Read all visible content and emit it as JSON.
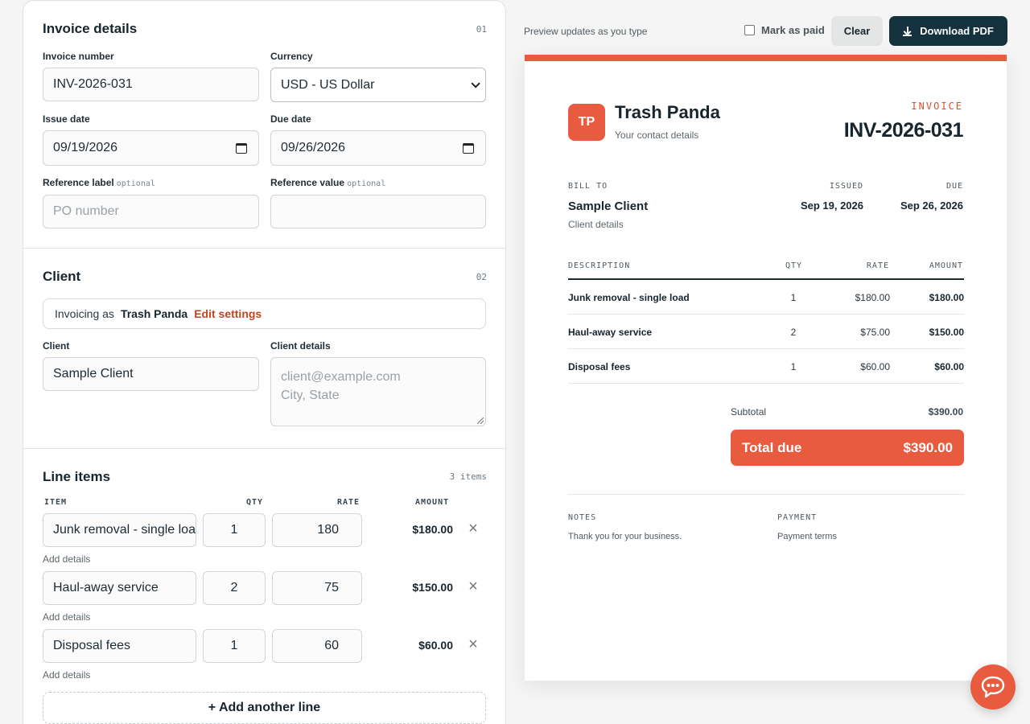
{
  "invoice_details": {
    "title": "Invoice details",
    "num": "01",
    "invoice_number_label": "Invoice number",
    "invoice_number": "INV-2026-031",
    "currency_label": "Currency",
    "currency": "USD - US Dollar",
    "issue_date_label": "Issue date",
    "issue_date": "09/19/2026",
    "due_date_label": "Due date",
    "due_date": "09/26/2026",
    "reference_label_label": "Reference label",
    "reference_value_label": "Reference value",
    "optional": "optional",
    "reference_label_placeholder": "PO number",
    "reference_value": ""
  },
  "client": {
    "title": "Client",
    "num": "02",
    "invoicing_as": "Invoicing as",
    "business_name": "Trash Panda",
    "edit_settings": "Edit settings",
    "client_label": "Client",
    "client_value": "Sample Client",
    "details_label": "Client details",
    "details_placeholder_1": "client@example.com",
    "details_placeholder_2": "City, State"
  },
  "line_items": {
    "title": "Line items",
    "count": "3 items",
    "headers": {
      "item": "ITEM",
      "qty": "QTY",
      "rate": "RATE",
      "amount": "AMOUNT"
    },
    "add_details": "Add details",
    "add_line": "+ Add another line",
    "rows": [
      {
        "item": "Junk removal - single load",
        "qty": "1",
        "rate": "180",
        "amount": "$180.00"
      },
      {
        "item": "Haul-away service",
        "qty": "2",
        "rate": "75",
        "amount": "$150.00"
      },
      {
        "item": "Disposal fees",
        "qty": "1",
        "rate": "60",
        "amount": "$60.00"
      }
    ]
  },
  "toolbar": {
    "hint": "Preview updates as you type",
    "mark_paid": "Mark as paid",
    "clear": "Clear",
    "download": "Download PDF"
  },
  "preview": {
    "logo_initials": "TP",
    "business_name": "Trash Panda",
    "contact": "Your contact details",
    "invoice_word": "INVOICE",
    "invoice_number": "INV-2026-031",
    "bill_to_label": "BILL TO",
    "client_name": "Sample Client",
    "client_details": "Client details",
    "issued_label": "ISSUED",
    "issued": "Sep 19, 2026",
    "due_label": "DUE",
    "due": "Sep 26, 2026",
    "headers": {
      "description": "DESCRIPTION",
      "qty": "QTY",
      "rate": "RATE",
      "amount": "AMOUNT"
    },
    "rows": [
      {
        "description": "Junk removal - single load",
        "qty": "1",
        "rate": "$180.00",
        "amount": "$180.00"
      },
      {
        "description": "Haul-away service",
        "qty": "2",
        "rate": "$75.00",
        "amount": "$150.00"
      },
      {
        "description": "Disposal fees",
        "qty": "1",
        "rate": "$60.00",
        "amount": "$60.00"
      }
    ],
    "subtotal_label": "Subtotal",
    "subtotal": "$390.00",
    "total_label": "Total due",
    "total": "$390.00",
    "notes_label": "NOTES",
    "notes": "Thank you for your business.",
    "payment_label": "PAYMENT",
    "payment": "Payment terms"
  },
  "colors": {
    "accent": "#e85b3f",
    "dark": "#14313e",
    "link": "#c2441f"
  },
  "icons": {
    "download": "download-icon",
    "chat": "chat-bubble-icon",
    "remove": "close-icon",
    "calendar": "calendar-icon"
  }
}
